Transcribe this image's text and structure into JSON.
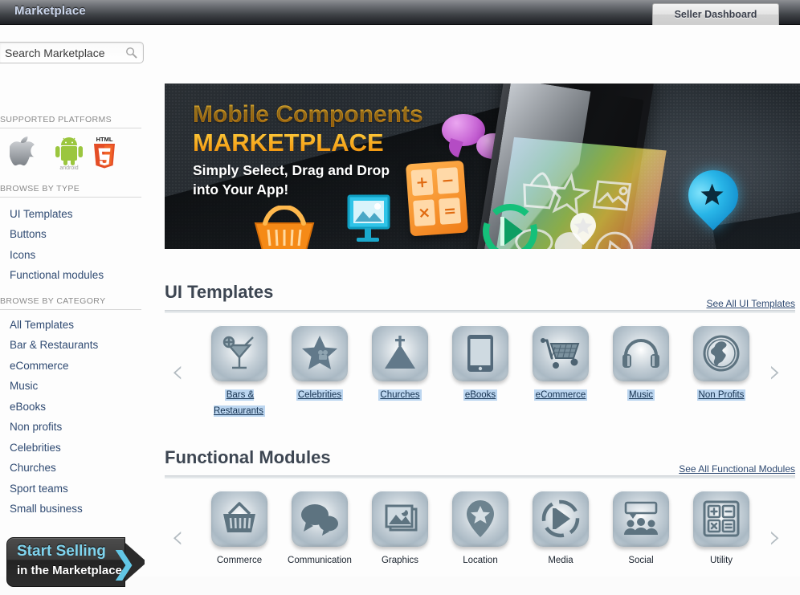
{
  "topbar": {
    "title": "Marketplace",
    "seller_dashboard": "Seller Dashboard"
  },
  "sidebar": {
    "search": {
      "value": "Search Marketplace",
      "placeholder": "Search Marketplace",
      "icon": "search-icon"
    },
    "supported_platforms": {
      "heading": "SUPPORTED PLATFORMS",
      "items": [
        {
          "name": "apple-icon",
          "label": "Apple"
        },
        {
          "name": "android-icon",
          "label": "android"
        },
        {
          "name": "html5-icon",
          "label": "HTML5"
        }
      ]
    },
    "browse_by_type": {
      "heading": "BROWSE BY TYPE",
      "items": [
        {
          "label": "UI Templates"
        },
        {
          "label": "Buttons"
        },
        {
          "label": "Icons"
        },
        {
          "label": "Functional modules"
        }
      ]
    },
    "browse_by_category": {
      "heading": "BROWSE BY CATEGORY",
      "items": [
        {
          "label": "All Templates"
        },
        {
          "label": "Bar & Restaurants"
        },
        {
          "label": "eCommerce"
        },
        {
          "label": "Music"
        },
        {
          "label": "eBooks"
        },
        {
          "label": "Non profits"
        },
        {
          "label": "Celebrities"
        },
        {
          "label": "Churches"
        },
        {
          "label": "Sport teams"
        },
        {
          "label": "Small business"
        }
      ]
    },
    "start_selling": {
      "line1": "Start Selling",
      "line2": "in the Marketplace",
      "chevron": "❯"
    }
  },
  "banner": {
    "title_line1": "Mobile Components",
    "title_line2": "MARKETPLACE",
    "subtitle": "Simply Select, Drag and Drop\ninto Your App!",
    "subtitle_line1": "Simply Select, Drag and Drop",
    "subtitle_line2": "into Your App!"
  },
  "sections": [
    {
      "title": "UI Templates",
      "see_all": "See All UI Templates",
      "prev_arrow": "‹",
      "next_arrow": "›",
      "highlighted": true,
      "tiles": [
        {
          "label": "Bars & Restaurants",
          "icon": "cocktail-icon"
        },
        {
          "label": "Celebrities",
          "icon": "star-icon"
        },
        {
          "label": "Churches",
          "icon": "church-icon"
        },
        {
          "label": "eBooks",
          "icon": "tablet-icon"
        },
        {
          "label": "eCommerce",
          "icon": "shopping-cart-icon"
        },
        {
          "label": "Music",
          "icon": "headphones-icon"
        },
        {
          "label": "Non Profits",
          "icon": "globe-icon"
        }
      ]
    },
    {
      "title": "Functional Modules",
      "see_all": "See All Functional Modules",
      "prev_arrow": "‹",
      "next_arrow": "›",
      "highlighted": false,
      "tiles": [
        {
          "label": "Commerce",
          "icon": "basket-icon"
        },
        {
          "label": "Communication",
          "icon": "chat-bubbles-icon"
        },
        {
          "label": "Graphics",
          "icon": "photos-icon"
        },
        {
          "label": "Location",
          "icon": "map-pin-star-icon"
        },
        {
          "label": "Media",
          "icon": "play-circle-icon"
        },
        {
          "label": "Social",
          "icon": "people-icon"
        },
        {
          "label": "Utility",
          "icon": "calculator-icon"
        }
      ]
    }
  ],
  "colors": {
    "accent_blue": "#2f4a72",
    "banner_orange": "#f5a11a",
    "start_selling_cyan": "#7fd4ee",
    "highlight": "#bcd6f0"
  }
}
